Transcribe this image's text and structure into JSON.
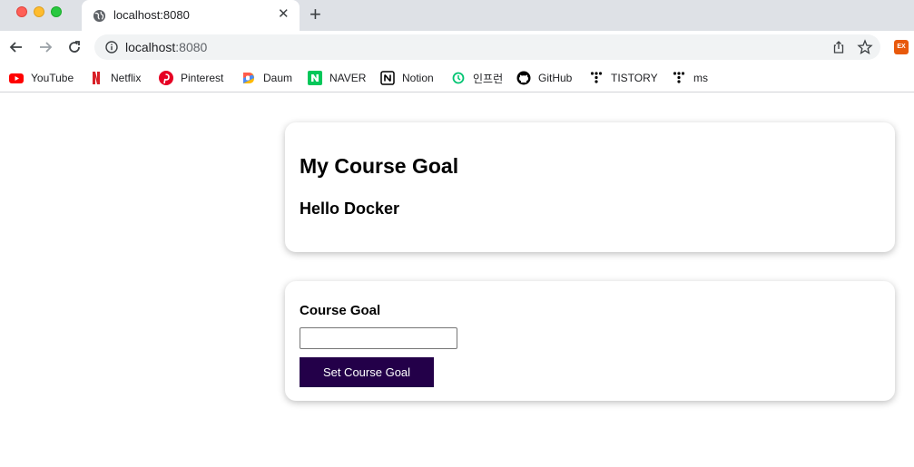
{
  "tab": {
    "title": "localhost:8080",
    "close": "✕",
    "new_tab": "+"
  },
  "address_bar": {
    "host": "localhost",
    "port": ":8080"
  },
  "extension": {
    "badge": "EX"
  },
  "bookmarks": [
    {
      "label": "YouTube",
      "icon": "youtube-icon"
    },
    {
      "label": "Netflix",
      "icon": "netflix-icon"
    },
    {
      "label": "Pinterest",
      "icon": "pinterest-icon"
    },
    {
      "label": "Daum",
      "icon": "daum-icon"
    },
    {
      "label": "NAVER",
      "icon": "naver-icon"
    },
    {
      "label": "Notion",
      "icon": "notion-icon"
    },
    {
      "label": "인프런",
      "icon": "inflearn-icon"
    },
    {
      "label": "GitHub",
      "icon": "github-icon"
    },
    {
      "label": "TISTORY",
      "icon": "tistory-icon"
    },
    {
      "label": "ms",
      "icon": "tistory-icon"
    }
  ],
  "goal_card": {
    "title": "My Course Goal",
    "goal": "Hello Docker"
  },
  "form_card": {
    "label": "Course Goal",
    "input_value": "",
    "button_label": "Set Course Goal"
  },
  "colors": {
    "accent": "#230049",
    "tab_strip": "#dee1e6"
  }
}
